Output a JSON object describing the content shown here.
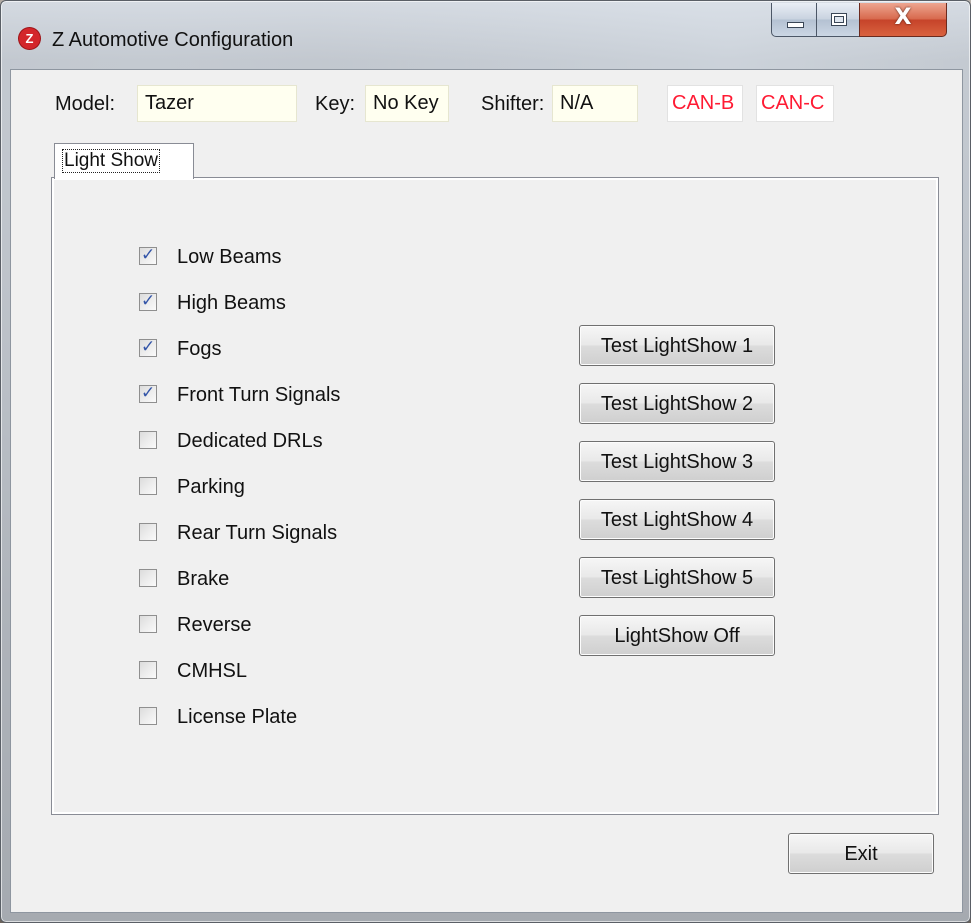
{
  "window": {
    "title": "Z Automotive Configuration",
    "icon_letter": "Z",
    "close_glyph": "X"
  },
  "header": {
    "model_label": "Model:",
    "model_value": "Tazer",
    "key_label": "Key:",
    "key_value": "No Key",
    "shifter_label": "Shifter:",
    "shifter_value": "N/A",
    "can_b": "CAN-B",
    "can_c": "CAN-C"
  },
  "tabs": [
    {
      "label": "Light Show",
      "selected": true
    }
  ],
  "lights": [
    {
      "label": "Low Beams",
      "checked": true
    },
    {
      "label": "High Beams",
      "checked": true
    },
    {
      "label": "Fogs",
      "checked": true
    },
    {
      "label": "Front Turn Signals",
      "checked": true
    },
    {
      "label": "Dedicated DRLs",
      "checked": false
    },
    {
      "label": "Parking",
      "checked": false
    },
    {
      "label": "Rear Turn Signals",
      "checked": false
    },
    {
      "label": "Brake",
      "checked": false
    },
    {
      "label": "Reverse",
      "checked": false
    },
    {
      "label": "CMHSL",
      "checked": false
    },
    {
      "label": "License Plate",
      "checked": false
    }
  ],
  "buttons": [
    {
      "label": "Test LightShow 1"
    },
    {
      "label": "Test LightShow 2"
    },
    {
      "label": "Test LightShow 3"
    },
    {
      "label": "Test LightShow 4"
    },
    {
      "label": "Test LightShow 5"
    },
    {
      "label": "LightShow Off"
    }
  ],
  "footer": {
    "exit_label": "Exit"
  },
  "colors": {
    "can_status": "#ff1a33",
    "field_bg": "#fffff0"
  }
}
